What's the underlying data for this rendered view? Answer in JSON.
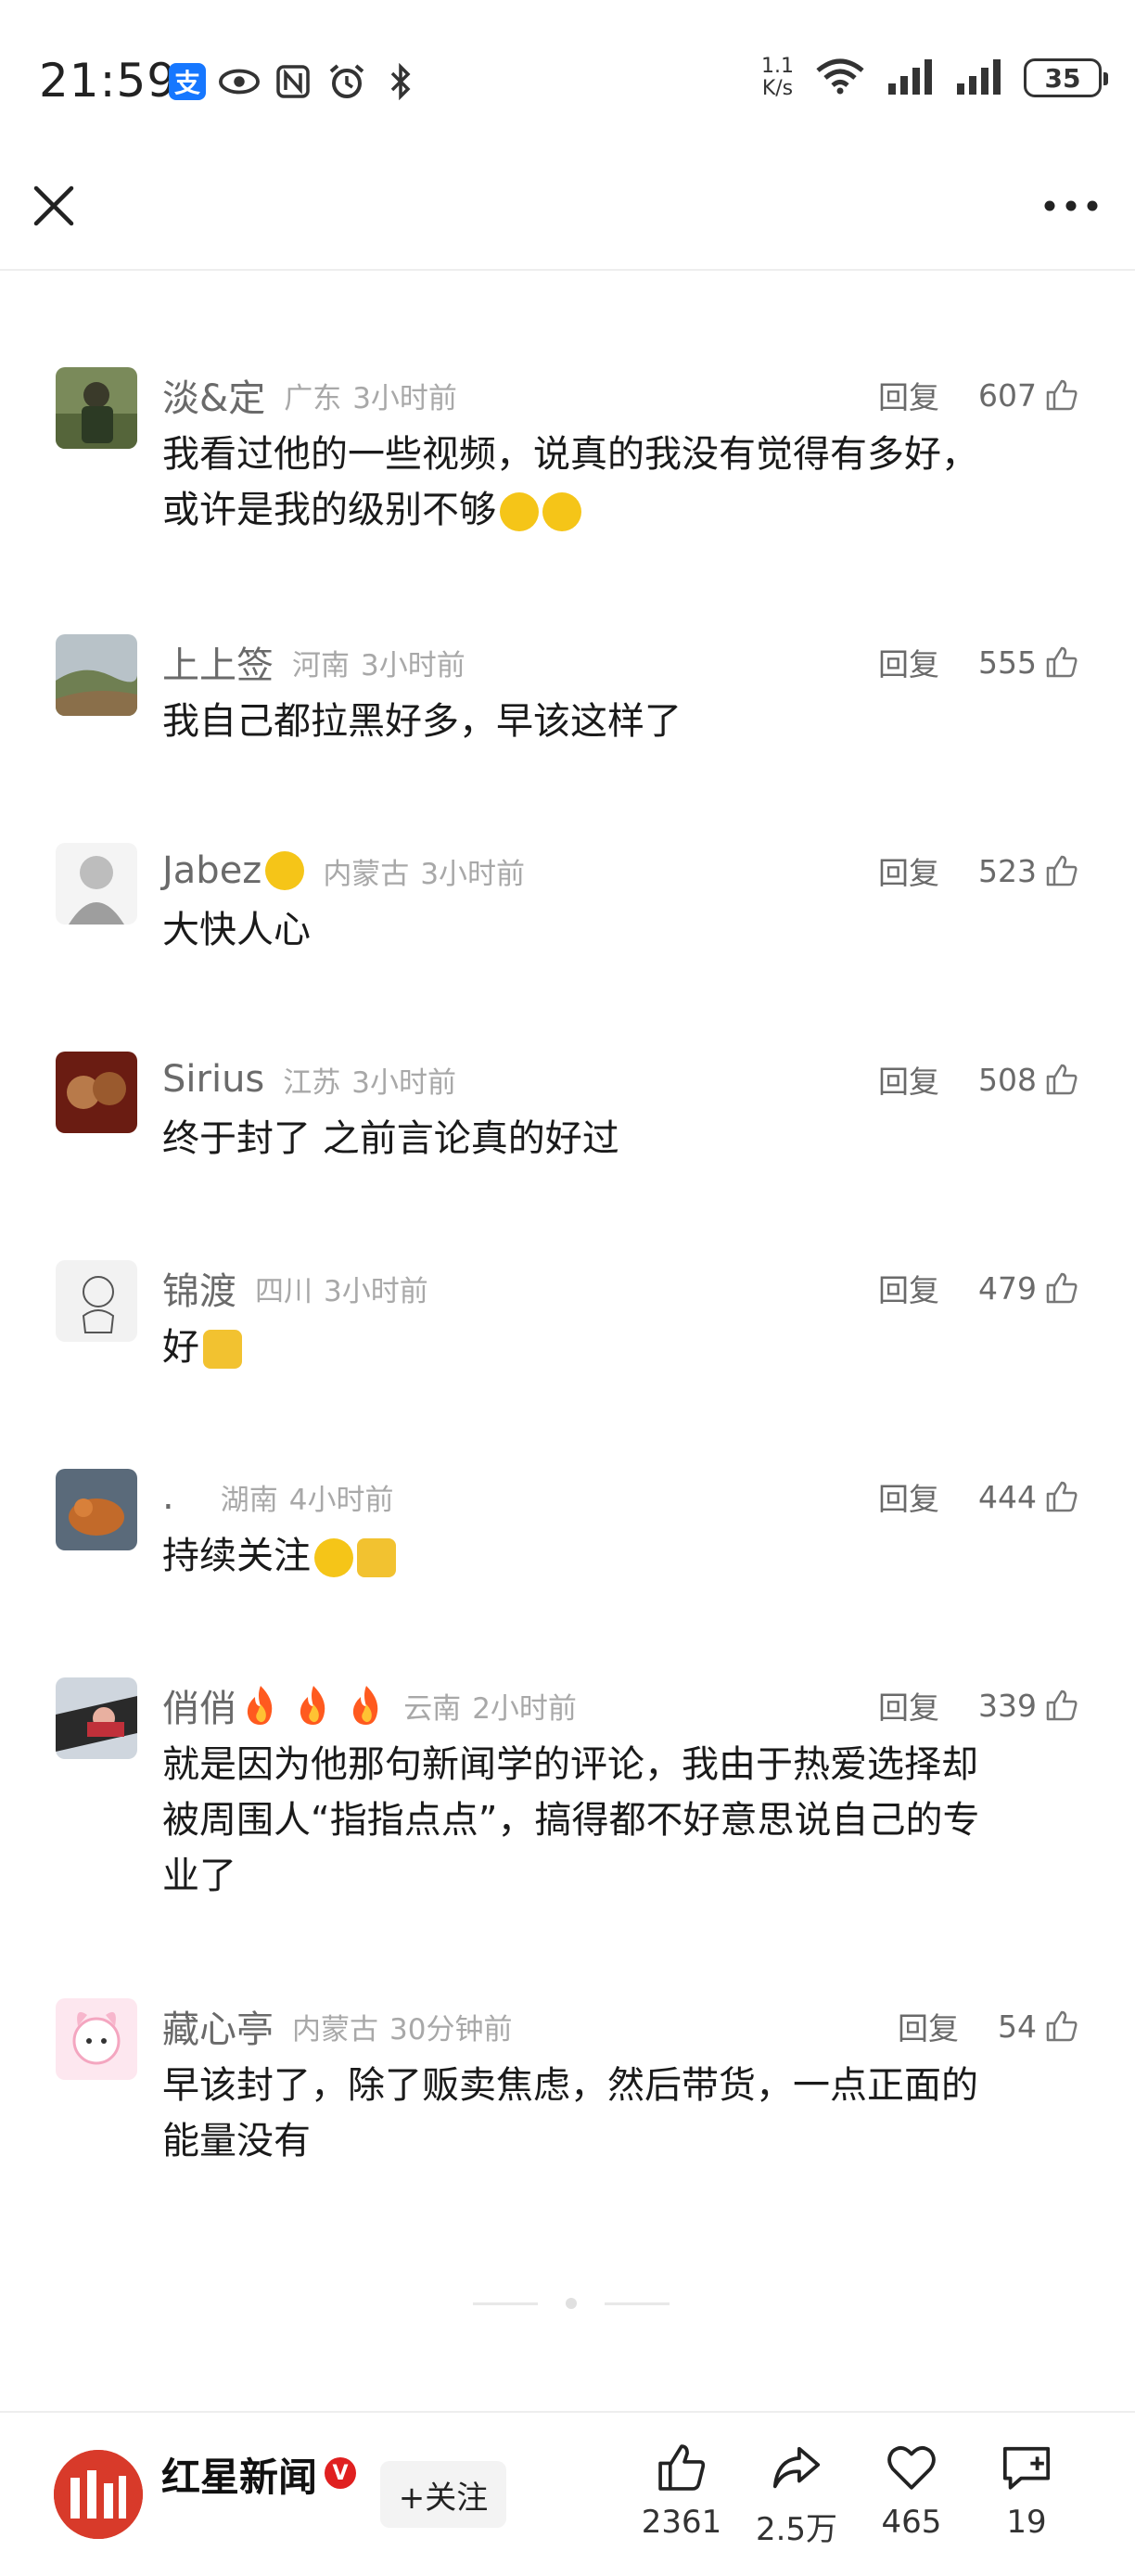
{
  "status_bar": {
    "time": "21:59",
    "alipay_glyph": "支",
    "net_speed_value": "1.1",
    "net_speed_unit": "K/s",
    "battery": "35"
  },
  "top_bar": {
    "close_icon": "close-icon",
    "more_icon": "more-icon"
  },
  "comments": [
    {
      "name": "淡&定",
      "location": "广东",
      "time": "3小时前",
      "reply": "回复",
      "likes": "607",
      "lines": [
        "我看过他的一些视频，说真的我没有觉得有多好，",
        "或许是我的级别不够"
      ]
    },
    {
      "name": "上上签",
      "location": "河南",
      "time": "3小时前",
      "reply": "回复",
      "likes": "555",
      "lines": [
        "我自己都拉黑好多，早该这样了"
      ]
    },
    {
      "name": "Jabez",
      "location": "内蒙古",
      "time": "3小时前",
      "reply": "回复",
      "likes": "523",
      "lines": [
        "大快人心"
      ]
    },
    {
      "name": "Sirius",
      "location": "江苏",
      "time": "3小时前",
      "reply": "回复",
      "likes": "508",
      "lines": [
        "终于封了 之前言论真的好过"
      ]
    },
    {
      "name": "锦渡",
      "location": "四川",
      "time": "3小时前",
      "reply": "回复",
      "likes": "479",
      "lines": [
        "好"
      ]
    },
    {
      "name": ".",
      "location": "湖南",
      "time": "4小时前",
      "reply": "回复",
      "likes": "444",
      "lines": [
        "持续关注"
      ]
    },
    {
      "name": "俏俏",
      "location": "云南",
      "time": "2小时前",
      "reply": "回复",
      "likes": "339",
      "lines": [
        "就是因为他那句新闻学的评论，我由于热爱选择却",
        "被周围人“指指点点”，搞得都不好意思说自己的专",
        "业了"
      ]
    },
    {
      "name": "藏心亭",
      "location": "内蒙古",
      "time": "30分钟前",
      "reply": "回复",
      "likes": "54",
      "lines": [
        "早该封了，除了贩卖焦虑，然后带货，一点正面的",
        "能量没有"
      ]
    }
  ],
  "bottom_bar": {
    "publisher": "红星新闻",
    "verified_badge": "V",
    "follow_label": "+关注",
    "like_count": "2361",
    "share_count": "2.5万",
    "favorite_count": "465",
    "comment_count": "19"
  },
  "colors": {
    "alipay": "#1677ff",
    "text": "#1a1a1a",
    "meta": "#a8a8a8",
    "brand_red": "#d83a2a"
  }
}
